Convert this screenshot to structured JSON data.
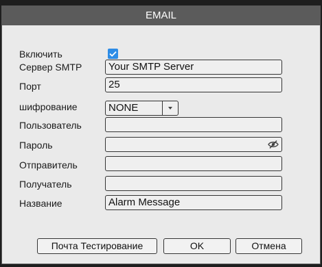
{
  "title": "EMAIL",
  "form": {
    "enable_label": "Включить",
    "enable_checked": true,
    "smtp_label": "Сервер SMTP",
    "smtp_value": "Your SMTP Server",
    "port_label": "Порт",
    "port_value": "25",
    "encryption_label": "шифрование",
    "encryption_value": "NONE",
    "user_label": "Пользователь",
    "user_value": "",
    "password_label": "Пароль",
    "password_value": "",
    "sender_label": "Отправитель",
    "sender_value": "",
    "recipient_label": "Получатель",
    "recipient_value": "",
    "subject_label": "Название",
    "subject_value": "Alarm Message"
  },
  "buttons": {
    "test": "Почта Тестирование",
    "ok": "OK",
    "cancel": "Отмена"
  },
  "colors": {
    "titlebar": "#5b5b5b",
    "checkbox": "#2d8ce6",
    "panel": "#eaeaea"
  },
  "icons": {
    "checkbox": "check-icon",
    "select_arrow": "triangle-down-icon",
    "password_toggle": "eye-slash-icon"
  }
}
